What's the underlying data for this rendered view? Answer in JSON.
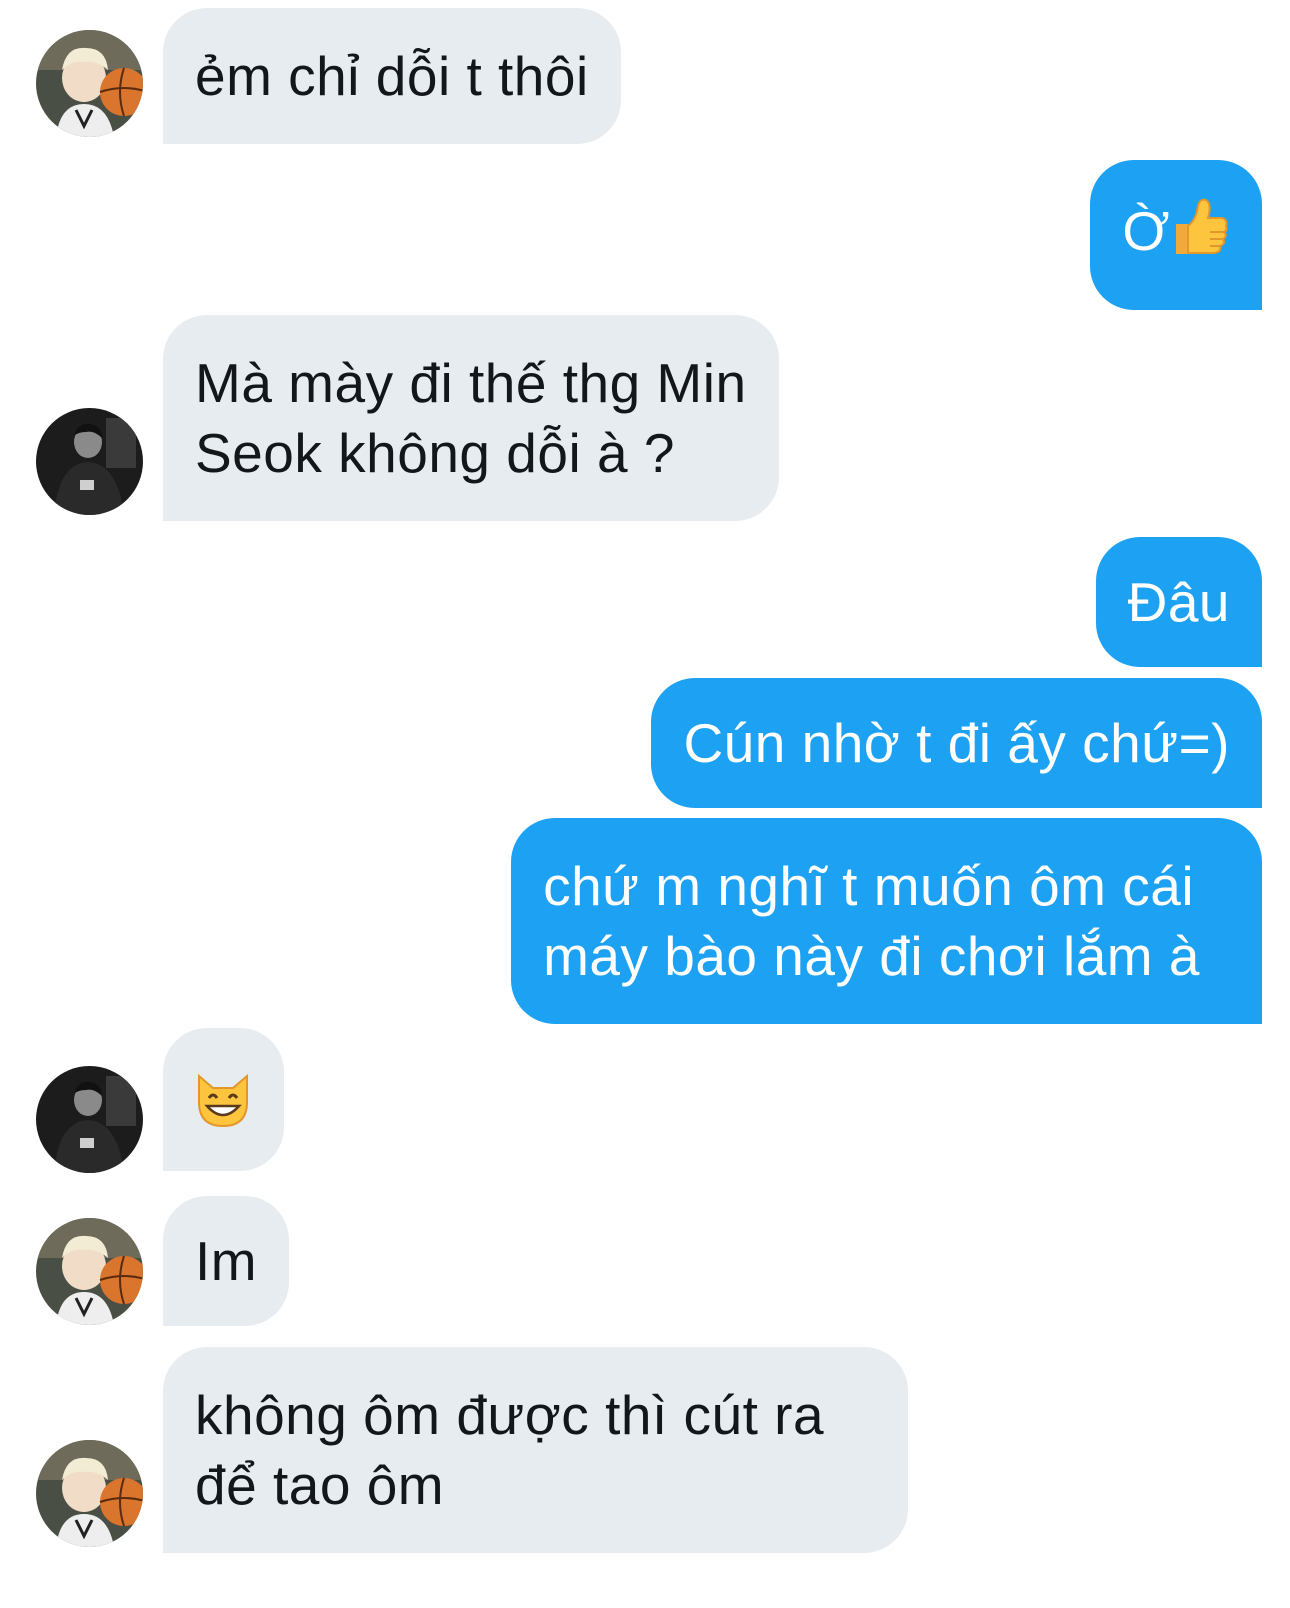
{
  "conversation": {
    "messages": [
      {
        "direction": "incoming",
        "avatar": "blonde-avatar",
        "lines": [
          "ẻm chỉ dỗi t thôi"
        ]
      },
      {
        "direction": "outgoing",
        "text": "Ờ",
        "emoji": "thumbs-up"
      },
      {
        "direction": "incoming",
        "avatar": "dark-avatar",
        "lines": [
          "Mà mày đi thế thg Min",
          "Seok không dỗi à ?"
        ]
      },
      {
        "direction": "outgoing",
        "lines": [
          "Đâu"
        ]
      },
      {
        "direction": "outgoing",
        "lines": [
          "Cún nhờ t đi ấy chứ=)"
        ]
      },
      {
        "direction": "outgoing",
        "lines": [
          "chứ m nghĩ t muốn ôm cái",
          "máy bào này đi chơi lắm à"
        ]
      },
      {
        "direction": "incoming",
        "avatar": "dark-avatar",
        "emoji": "grinning-cat"
      },
      {
        "direction": "incoming",
        "avatar": "blonde-avatar",
        "lines": [
          "Im"
        ]
      },
      {
        "direction": "incoming",
        "avatar": "blonde-avatar",
        "lines": [
          "không ôm được thì cút ra",
          "để tao ôm"
        ]
      }
    ]
  },
  "colors": {
    "incoming_bubble": "#e6ecf0",
    "outgoing_bubble": "#1da1f2",
    "incoming_text": "#14171a",
    "outgoing_text": "#ffffff"
  }
}
